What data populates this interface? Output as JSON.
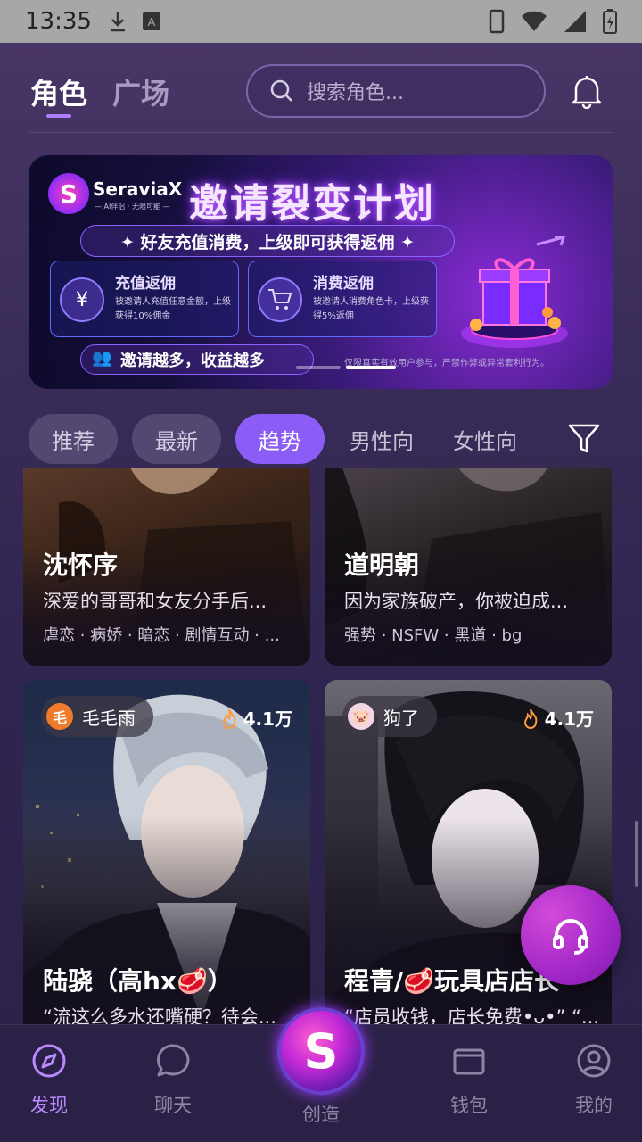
{
  "status_bar": {
    "time": "13:35"
  },
  "header": {
    "tab_active": "角色",
    "tab_inactive": "广场",
    "search_placeholder": "搜索角色..."
  },
  "banner": {
    "logo_text": "SeraviaX",
    "logo_sub": "— AI伴侣 · 无限可能 —",
    "title": "邀请裂变计划",
    "subtitle": "✦ 好友充值消费，上级即可获得返佣 ✦",
    "card1": {
      "title": "充值返佣",
      "desc": "被邀请人充值任意金额，上级获得10%佣金"
    },
    "card2": {
      "title": "消费返佣",
      "desc": "被邀请人消费角色卡，上级获得5%返佣"
    },
    "bottom": "邀请越多，收益越多",
    "note": "仅限真实有效用户参与，严禁作弊或异常套利行为。"
  },
  "filters": [
    "推荐",
    "最新",
    "趋势",
    "男性向",
    "女性向"
  ],
  "active_filter": "趋势",
  "cards": [
    {
      "name": "沈怀序",
      "desc": "深爱的哥哥和女友分手后...",
      "tags": "虐恋 · 病娇 · 暗恋 · 剧情互动 · ..."
    },
    {
      "name": "道明朝",
      "desc": "因为家族破产，你被迫成...",
      "tags": "强势 · NSFW · 黑道 · bg"
    },
    {
      "name": "陆骁（高hx🥩）",
      "desc": "“流这么多水还嘴硬？待会...",
      "author": "毛毛雨",
      "author_initial": "毛",
      "heat": "4.1万"
    },
    {
      "name": "程青/🥩玩具店店长",
      "desc": "“店员收钱，店长免费•ᴗ•” “...",
      "author": "狗了",
      "author_initial": "🐷",
      "heat": "4.1万"
    }
  ],
  "nav": {
    "discover": "发现",
    "chat": "聊天",
    "create": "创造",
    "wallet": "钱包",
    "me": "我的"
  },
  "colors": {
    "accent": "#8b5cf6",
    "nav_active": "#b98bff",
    "support": "#b22fd0"
  }
}
